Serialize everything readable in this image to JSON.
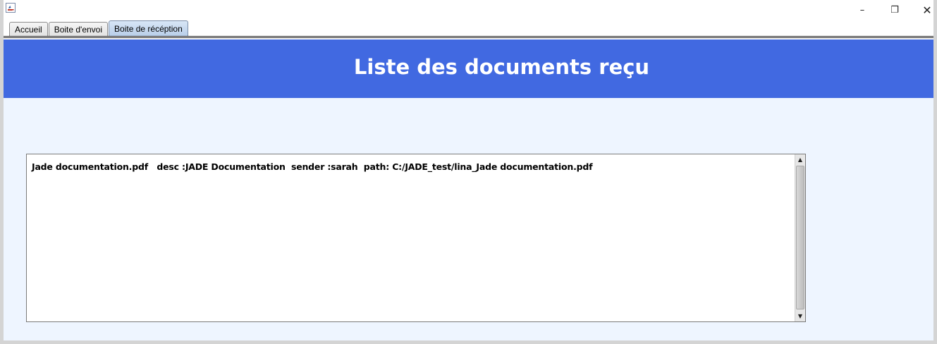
{
  "window": {
    "icon": "java-coffee-icon",
    "controls": {
      "minimize": "–",
      "restore": "❐",
      "close": "✕"
    }
  },
  "tabs": [
    {
      "label": "Accueil",
      "active": false
    },
    {
      "label": "Boite d'envoi",
      "active": false
    },
    {
      "label": "Boite de récéption",
      "active": true
    }
  ],
  "banner": {
    "title": "Liste des documents reçu",
    "color": "#4169e1"
  },
  "documents": {
    "lines": [
      "Jade documentation.pdf   desc :JADE Documentation  sender :sarah  path: C:/JADE_test/lina_Jade documentation.pdf"
    ]
  },
  "colors": {
    "background": "#eef5ff",
    "banner": "#4169e1"
  }
}
